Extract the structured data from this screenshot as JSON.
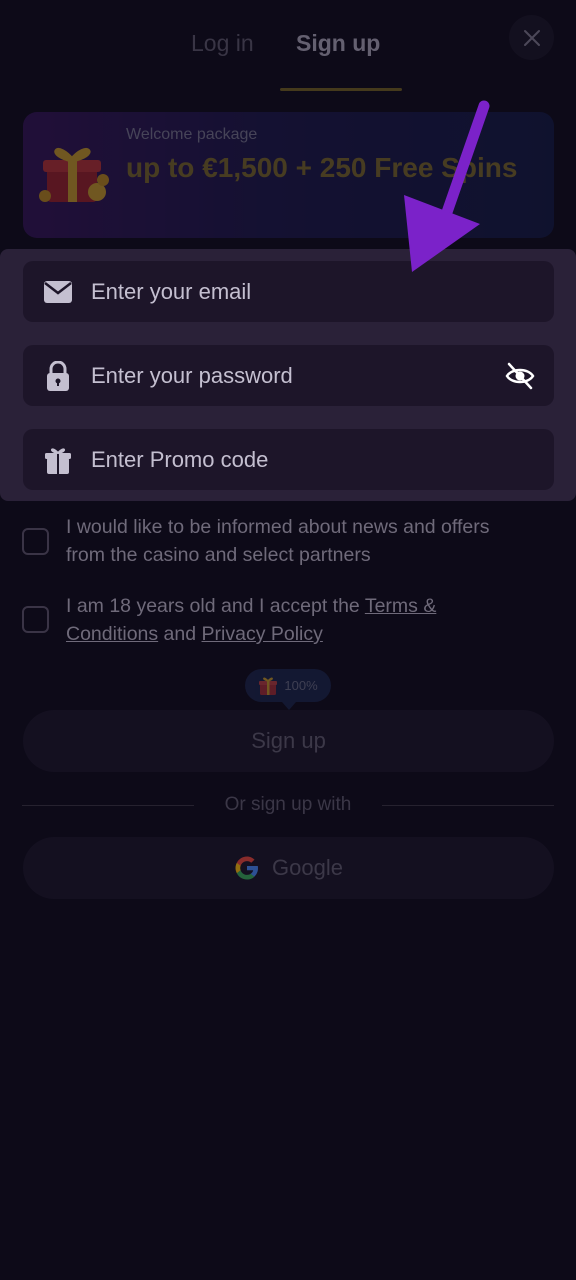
{
  "tabs": {
    "login": "Log in",
    "signup": "Sign up",
    "active": "signup"
  },
  "banner": {
    "kicker": "Welcome package",
    "headline": "up to €1,500 + 250 Free Spins"
  },
  "form": {
    "email_placeholder": "Enter your email",
    "password_placeholder": "Enter your password",
    "promo_placeholder": "Enter Promo code"
  },
  "consents": {
    "news": "I would like to be informed about news and offers from the casino and select partners",
    "age_prefix": "I am 18 years old and I accept the ",
    "terms_link": "Terms & Conditions",
    "and": " and ",
    "privacy_link": "Privacy Policy"
  },
  "bonus_badge": {
    "value": "100%"
  },
  "buttons": {
    "signup": "Sign up",
    "divider": "Or sign up with",
    "google": "Google"
  },
  "icons": {
    "close": "close-icon",
    "email": "envelope-icon",
    "password": "lock-icon",
    "promo": "gift-icon",
    "visibility": "eye-off-icon",
    "google": "google-icon"
  },
  "colors": {
    "background": "#0d0a18",
    "panel": "#2a2138",
    "field": "#1d1529",
    "accent_gold": "#8f7a2d",
    "arrow": "#7b22c9"
  }
}
